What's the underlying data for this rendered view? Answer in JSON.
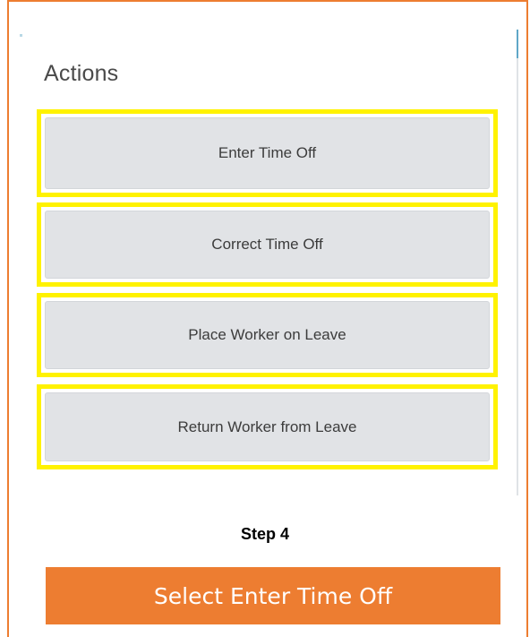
{
  "panel": {
    "title": "Actions"
  },
  "actions": [
    {
      "label": "Enter Time Off"
    },
    {
      "label": "Correct Time Off"
    },
    {
      "label": "Place Worker on Leave"
    },
    {
      "label": "Return Worker from Leave"
    }
  ],
  "instruction": {
    "step": "Step 4",
    "text": "Select Enter Time Off"
  },
  "colors": {
    "frame_border": "#ED7D31",
    "highlight": "#FFF200",
    "button_bg": "#E1E3E6",
    "banner_bg": "#ED7D31",
    "banner_text": "#FFFFFF"
  }
}
